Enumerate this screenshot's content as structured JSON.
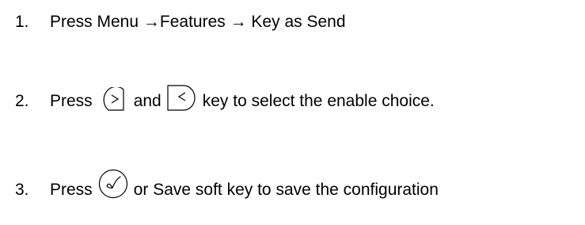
{
  "steps": [
    {
      "number": "1.",
      "text": "Press Menu →Features → Key as Send"
    },
    {
      "number": "2.",
      "press": "Press",
      "right_key_icon": "right-arrow-key-icon",
      "and": "and",
      "left_key_icon": "left-arrow-key-icon",
      "rest": "key to select the enable choice."
    },
    {
      "number": "3.",
      "press": "Press",
      "ok_key_icon": "ok-check-key-icon",
      "rest": "or Save soft key to save the configuration"
    }
  ]
}
